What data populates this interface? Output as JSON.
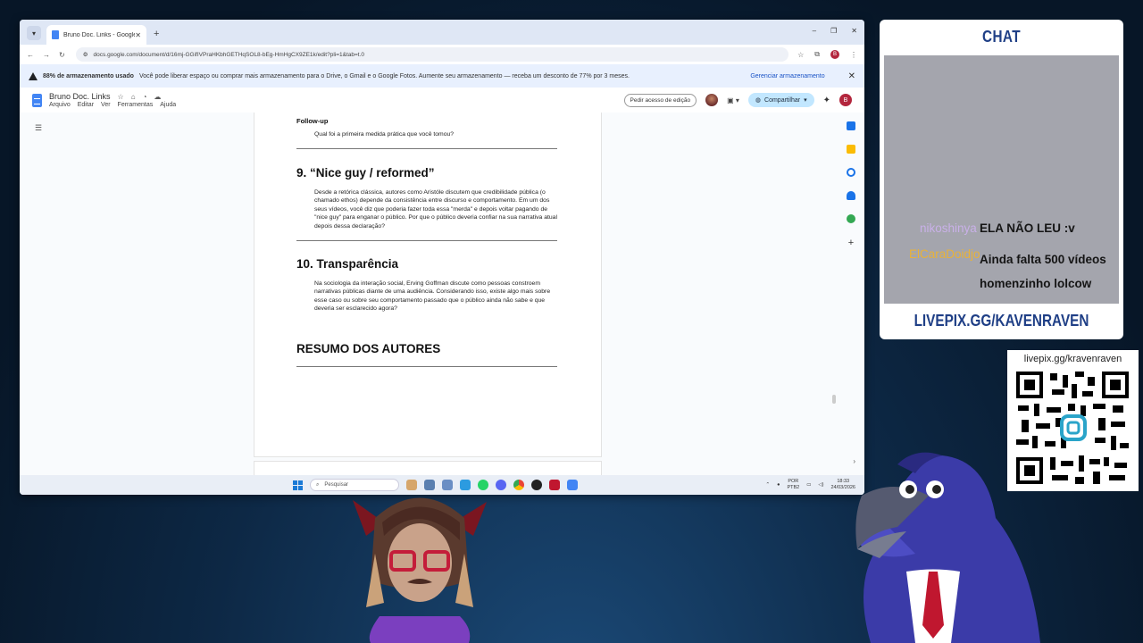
{
  "browser": {
    "tab_title": "Bruno Doc. Links - Google Docs",
    "url": "docs.google.com/document/d/16mj-GGifIVPraHKbhGETHqSOL8-bEg-HmHgCX9ZE1k/edit?pli=1&tab=t.0",
    "profile_initial": "B"
  },
  "banner": {
    "title": "88% de armazenamento usado",
    "message": "Você pode liberar espaço ou comprar mais armazenamento para o Drive, o Gmail e o Google Fotos. Aumente seu armazenamento — receba um desconto de 77% por 3 meses.",
    "action": "Gerenciar armazenamento"
  },
  "docs": {
    "title": "Bruno Doc. Links",
    "menus": [
      "Arquivo",
      "Editar",
      "Ver",
      "Ferramentas",
      "Ajuda"
    ],
    "request_edit": "Pedir acesso de edição",
    "share": "Compartilhar",
    "profile_initial": "B"
  },
  "content": {
    "followup_title": "Follow-up",
    "followup_q": "Qual foi a primeira medida prática que você tomou?",
    "s9_title": "9. “Nice guy / reformed”",
    "s9_q": "Desde a retórica clássica, autores como Aristóle discutem que credibilidade pública (o chamado ethos) depende da consistência entre discurso e comportamento. Em um dos seus vídeos, você diz que poderia fazer toda essa \"merda\" e depois voltar pagando de \"nice guy\" para enganar o público. Por que o público deveria confiar na sua narrativa atual depois dessa declaração?",
    "s10_title": "10. Transparência",
    "s10_q": "Na sociologia da interação social, Erving Goffman discute como pessoas constroem narrativas públicas diante de uma audiência. Considerando isso, existe algo mais sobre esse caso ou sobre seu comportamento passado que o público ainda não sabe e que deveria ser esclarecido agora?",
    "resumo_title": "RESUMO DOS AUTORES"
  },
  "taskbar": {
    "search_placeholder": "Pesquisar",
    "lang_top": "POR",
    "lang_bottom": "PTB2",
    "time": "18:33",
    "date": "24/03/2026"
  },
  "chat": {
    "title": "CHAT",
    "messages": [
      {
        "user": "nikoshinya",
        "text": "ELA NÃO LEU :v",
        "color": "#c9b0e8"
      },
      {
        "user": "ElCaraDoidjo",
        "text": "Ainda falta 500 vídeos homenzinho lolcow",
        "color": "#e8b23a"
      }
    ],
    "footer": "LIVEPIX.GG/KAVENRAVEN"
  },
  "qr": {
    "caption": "livepix.gg/kravenraven"
  },
  "colors": {
    "chat_title": "#1f3f86",
    "share_bg": "#c2e7ff",
    "banner_bg": "#e8f0fe"
  }
}
